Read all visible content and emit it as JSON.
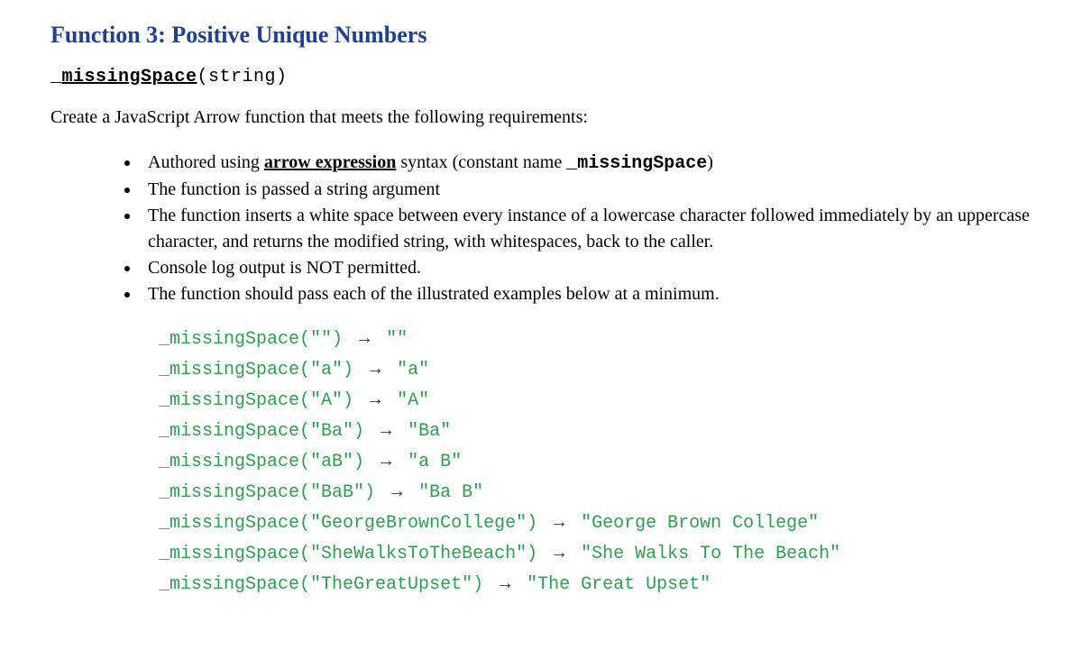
{
  "heading": "Function 3: Positive Unique Numbers",
  "signature": {
    "underscore": "_",
    "fnName": "missingSpace",
    "params": "(string)"
  },
  "intro": "Create a JavaScript Arrow function that meets the following requirements:",
  "bullets": {
    "item1_prefix": "Authored using ",
    "item1_arrow": "arrow expression",
    "item1_mid": " syntax (constant name  ",
    "item1_const": "_missingSpace",
    "item1_suffix": ")",
    "item2": "The function is passed a string argument",
    "item3": "The function inserts a white space between every instance of a lowercase character followed immediately by an uppercase character, and returns the modified string, with whitespaces, back to the caller.",
    "item4": "Console log output is NOT permitted.",
    "item5": "The function should pass each of the illustrated examples below at a minimum."
  },
  "examples": [
    {
      "call": "missingSpace(\"\") ",
      "arrow": "→",
      "result": " \"\""
    },
    {
      "call": "missingSpace(\"a\") ",
      "arrow": "→",
      "result": " \"a\""
    },
    {
      "call": "missingSpace(\"A\") ",
      "arrow": "→",
      "result": " \"A\""
    },
    {
      "call": "missingSpace(\"Ba\") ",
      "arrow": "→",
      "result": " \"Ba\""
    },
    {
      "call": "missingSpace(\"aB\") ",
      "arrow": "→",
      "result": " \"a B\""
    },
    {
      "call": "missingSpace(\"BaB\") ",
      "arrow": "→",
      "result": " \"Ba B\""
    },
    {
      "call": "missingSpace(\"GeorgeBrownCollege\") ",
      "arrow": "→",
      "result": " \"George Brown College\""
    },
    {
      "call": "missingSpace(\"SheWalksToTheBeach\") ",
      "arrow": "→",
      "result": " \"She Walks To The Beach\""
    },
    {
      "call": "missingSpace(\"TheGreatUpset\") ",
      "arrow": "→",
      "result": " \"The Great Upset\""
    }
  ]
}
